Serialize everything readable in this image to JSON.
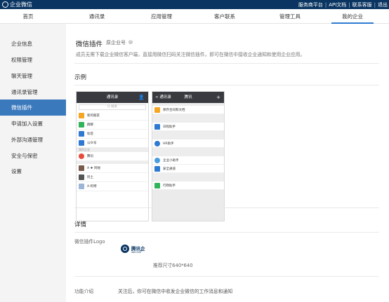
{
  "app": {
    "title": "企业微信"
  },
  "topbar": {
    "links": [
      "服务商平台",
      "API文档",
      "联系客服",
      "退出"
    ]
  },
  "nav": {
    "tabs": [
      "首页",
      "通讯录",
      "应用管理",
      "客户联系",
      "管理工具",
      "我的企业"
    ],
    "active": "我的企业"
  },
  "sidebar": {
    "items": [
      "企业信息",
      "权限管理",
      "聊天管理",
      "通讯录管理",
      "微信插件",
      "申请加入设置",
      "外部沟通管理",
      "安全与保密",
      "设置"
    ],
    "active": "微信插件"
  },
  "plugin": {
    "title": "微信插件",
    "corp_no_label": "原企业号",
    "help_icon": "?",
    "description": "成员无需下载企业微信客户端，直接用微信扫码关注微信插件，即可在微信中接收企业通知和使用企业应用。"
  },
  "example": {
    "heading": "示例",
    "phone1": {
      "title": "通讯录",
      "search_placeholder": "Q 搜索",
      "rows": [
        "新的朋友",
        "群聊",
        "标签",
        "公众号"
      ],
      "category": "我的企业",
      "contacts": [
        "腾讯",
        "A ❖ 阿秘",
        "阿土",
        "A-阿特"
      ]
    },
    "phone2": {
      "back": "< 通讯录",
      "title": "腾讯",
      "plus": "+",
      "rows": [
        "保存合同和文档",
        "日程助手",
        "HR助手",
        "企业小助手",
        "安全通道",
        "行政助手"
      ]
    }
  },
  "detail": {
    "heading": "详情",
    "logo_label": "微信插件Logo",
    "logo_text": "腾讯企",
    "logo_sub": "WeCHAT",
    "size_hint": "推荐尺寸640*640",
    "intro_label": "功能介绍",
    "intro_text": "关注后，你可在微信中收发企业微信的工作消息和通知"
  },
  "colors": {
    "topbar": "#0a3562",
    "active_sidebar": "#3b79bd",
    "active_tab_underline": "#2e7ad1",
    "sidebar_bg": "#f4f4f4"
  }
}
